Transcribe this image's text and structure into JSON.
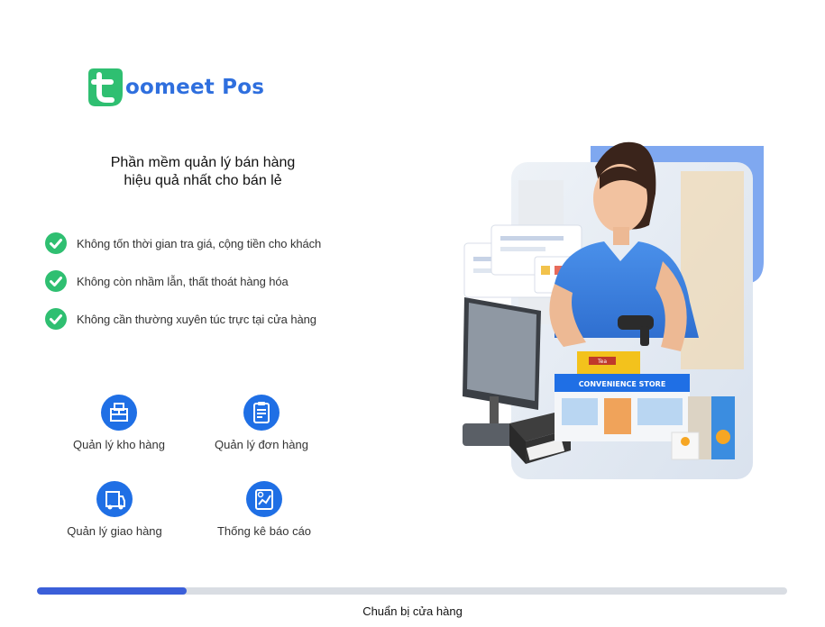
{
  "app": {
    "logo_text": "oomeet Pos",
    "brand_color": "#2f6fde",
    "logo_badge_color": "#2fbf71"
  },
  "tagline": {
    "line1": "Phần mềm quản lý bán hàng",
    "line2": "hiệu quả nhất cho bán lẻ"
  },
  "benefits": [
    {
      "icon": "check-circle-icon",
      "text": "Không tốn thời gian tra giá, cộng tiền cho khách"
    },
    {
      "icon": "check-circle-icon",
      "text": "Không còn nhầm lẫn, thất thoát hàng hóa"
    },
    {
      "icon": "check-circle-icon",
      "text": "Không cần thường xuyên túc trực tại cửa hàng"
    }
  ],
  "features": [
    {
      "icon": "warehouse-icon",
      "label": "Quản lý kho hàng"
    },
    {
      "icon": "order-clipboard-icon",
      "label": "Quản lý đơn hàng"
    },
    {
      "icon": "delivery-icon",
      "label": "Quản lý giao hàng"
    },
    {
      "icon": "report-chart-icon",
      "label": "Thống kê báo cáo"
    }
  ],
  "hero": {
    "store_sign": "CONVENIENCE STORE",
    "product_label": "Tea"
  },
  "progress": {
    "fraction": 0.2,
    "color": "#3b5fd9",
    "status_text": "Chuẩn bị cửa hàng"
  },
  "colors": {
    "check_green": "#2fbf71",
    "feature_blue": "#1f6fe5"
  }
}
